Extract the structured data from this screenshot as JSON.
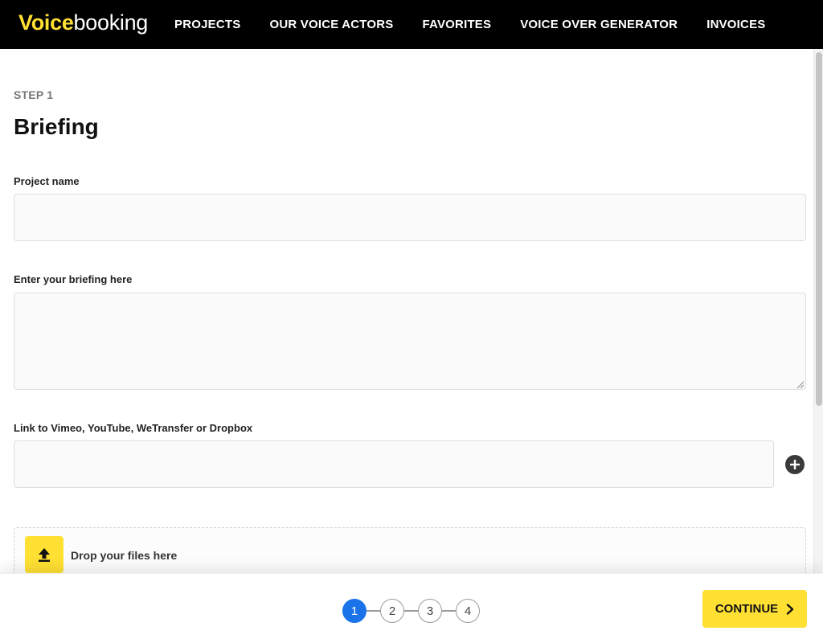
{
  "header": {
    "logo_bold": "Voice",
    "logo_regular": "booking",
    "nav": [
      {
        "label": "PROJECTS"
      },
      {
        "label": "OUR VOICE ACTORS"
      },
      {
        "label": "FAVORITES"
      },
      {
        "label": "VOICE OVER GENERATOR"
      },
      {
        "label": "INVOICES"
      }
    ]
  },
  "form": {
    "step_label": "STEP 1",
    "title": "Briefing",
    "project_name": {
      "label": "Project name",
      "value": ""
    },
    "briefing": {
      "label": "Enter your briefing here",
      "value": ""
    },
    "link": {
      "label": "Link to Vimeo, YouTube, WeTransfer or Dropbox",
      "value": ""
    },
    "dropzone": {
      "label": "Drop your files here"
    }
  },
  "footer": {
    "steps": [
      "1",
      "2",
      "3",
      "4"
    ],
    "active_step": 1,
    "continue_label": "CONTINUE"
  },
  "colors": {
    "accent_yellow": "#ffe033",
    "active_blue": "#1a73e8",
    "header_bg": "#000000"
  },
  "icons": {
    "add": "plus-circle-icon",
    "upload": "upload-arrow-icon",
    "continue": "chevron-right-icon"
  }
}
